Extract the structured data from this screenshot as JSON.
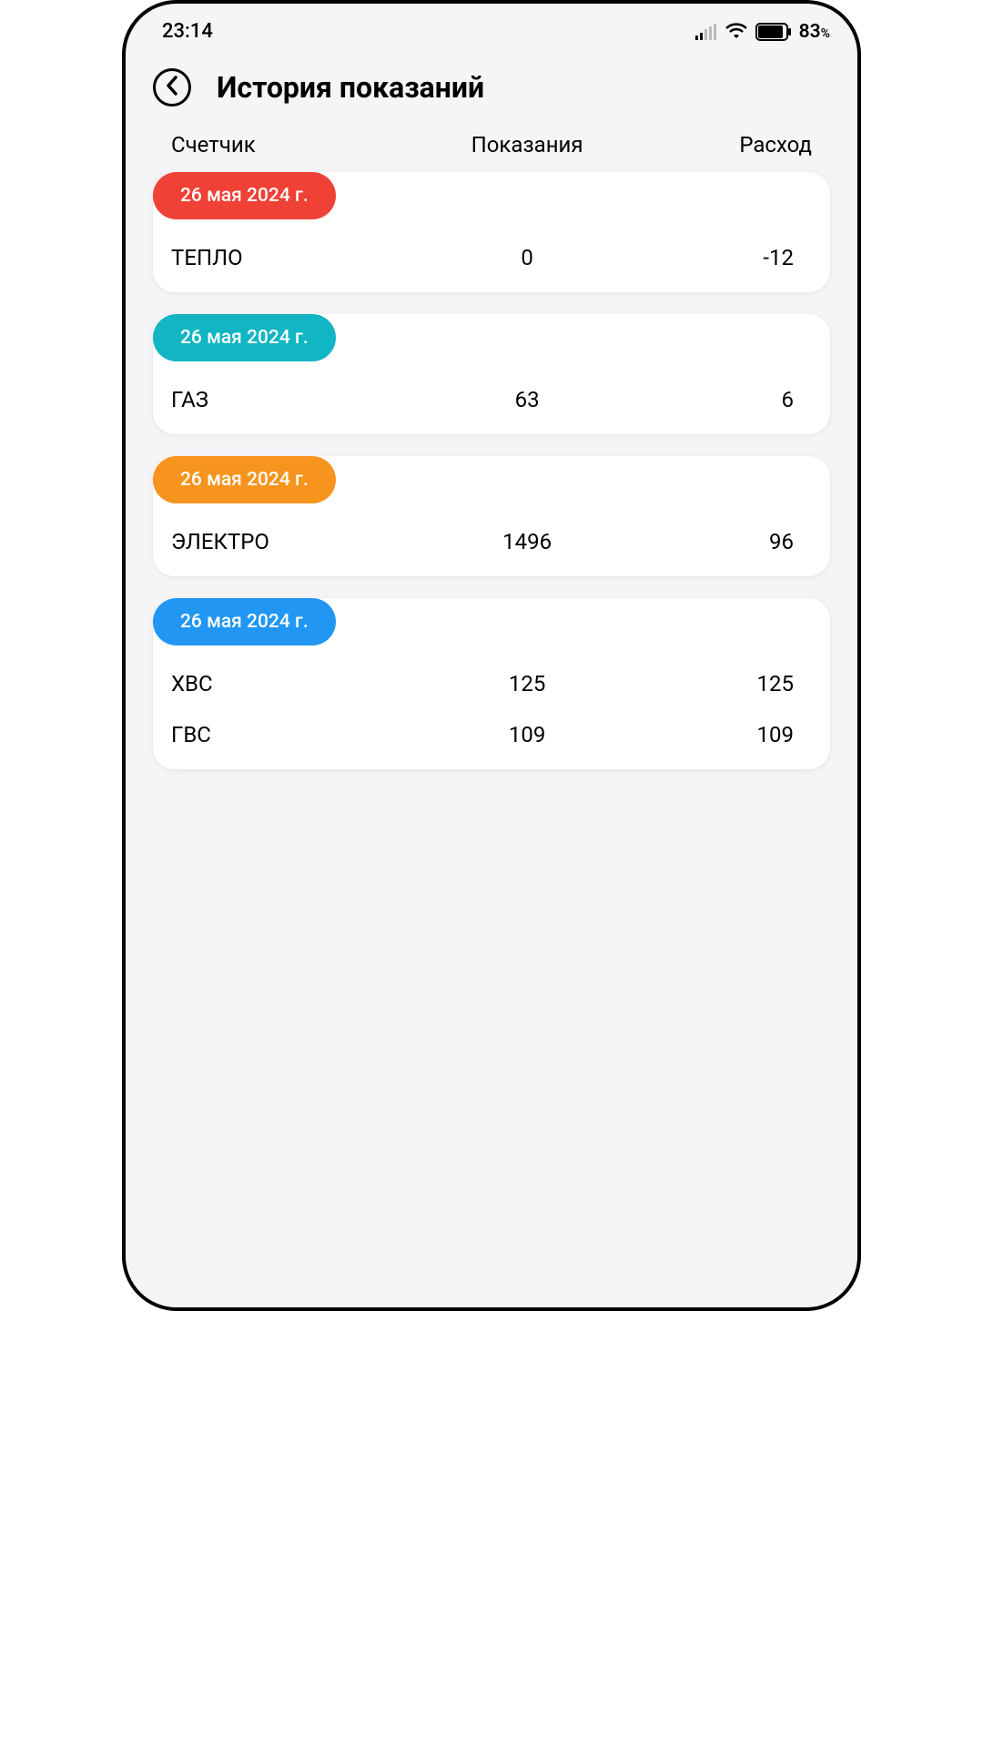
{
  "status_bar": {
    "time": "23:14",
    "battery_pct": "83",
    "battery_pct_suffix": "%"
  },
  "header": {
    "title": "История показаний"
  },
  "columns": {
    "meter": "Счетчик",
    "reading": "Показания",
    "usage": "Расход"
  },
  "cards": [
    {
      "date": "26 мая 2024 г.",
      "color": "#ef4136",
      "rows": [
        {
          "meter": "ТЕПЛО",
          "reading": "0",
          "usage": "-12"
        }
      ]
    },
    {
      "date": "26 мая 2024 г.",
      "color": "#12b5c3",
      "rows": [
        {
          "meter": "ГАЗ",
          "reading": "63",
          "usage": "6"
        }
      ]
    },
    {
      "date": "26 мая 2024 г.",
      "color": "#f7941d",
      "rows": [
        {
          "meter": "ЭЛЕКТРО",
          "reading": "1496",
          "usage": "96"
        }
      ]
    },
    {
      "date": "26 мая 2024 г.",
      "color": "#2196f3",
      "rows": [
        {
          "meter": "ХВС",
          "reading": "125",
          "usage": "125"
        },
        {
          "meter": "ГВС",
          "reading": "109",
          "usage": "109"
        }
      ]
    }
  ]
}
